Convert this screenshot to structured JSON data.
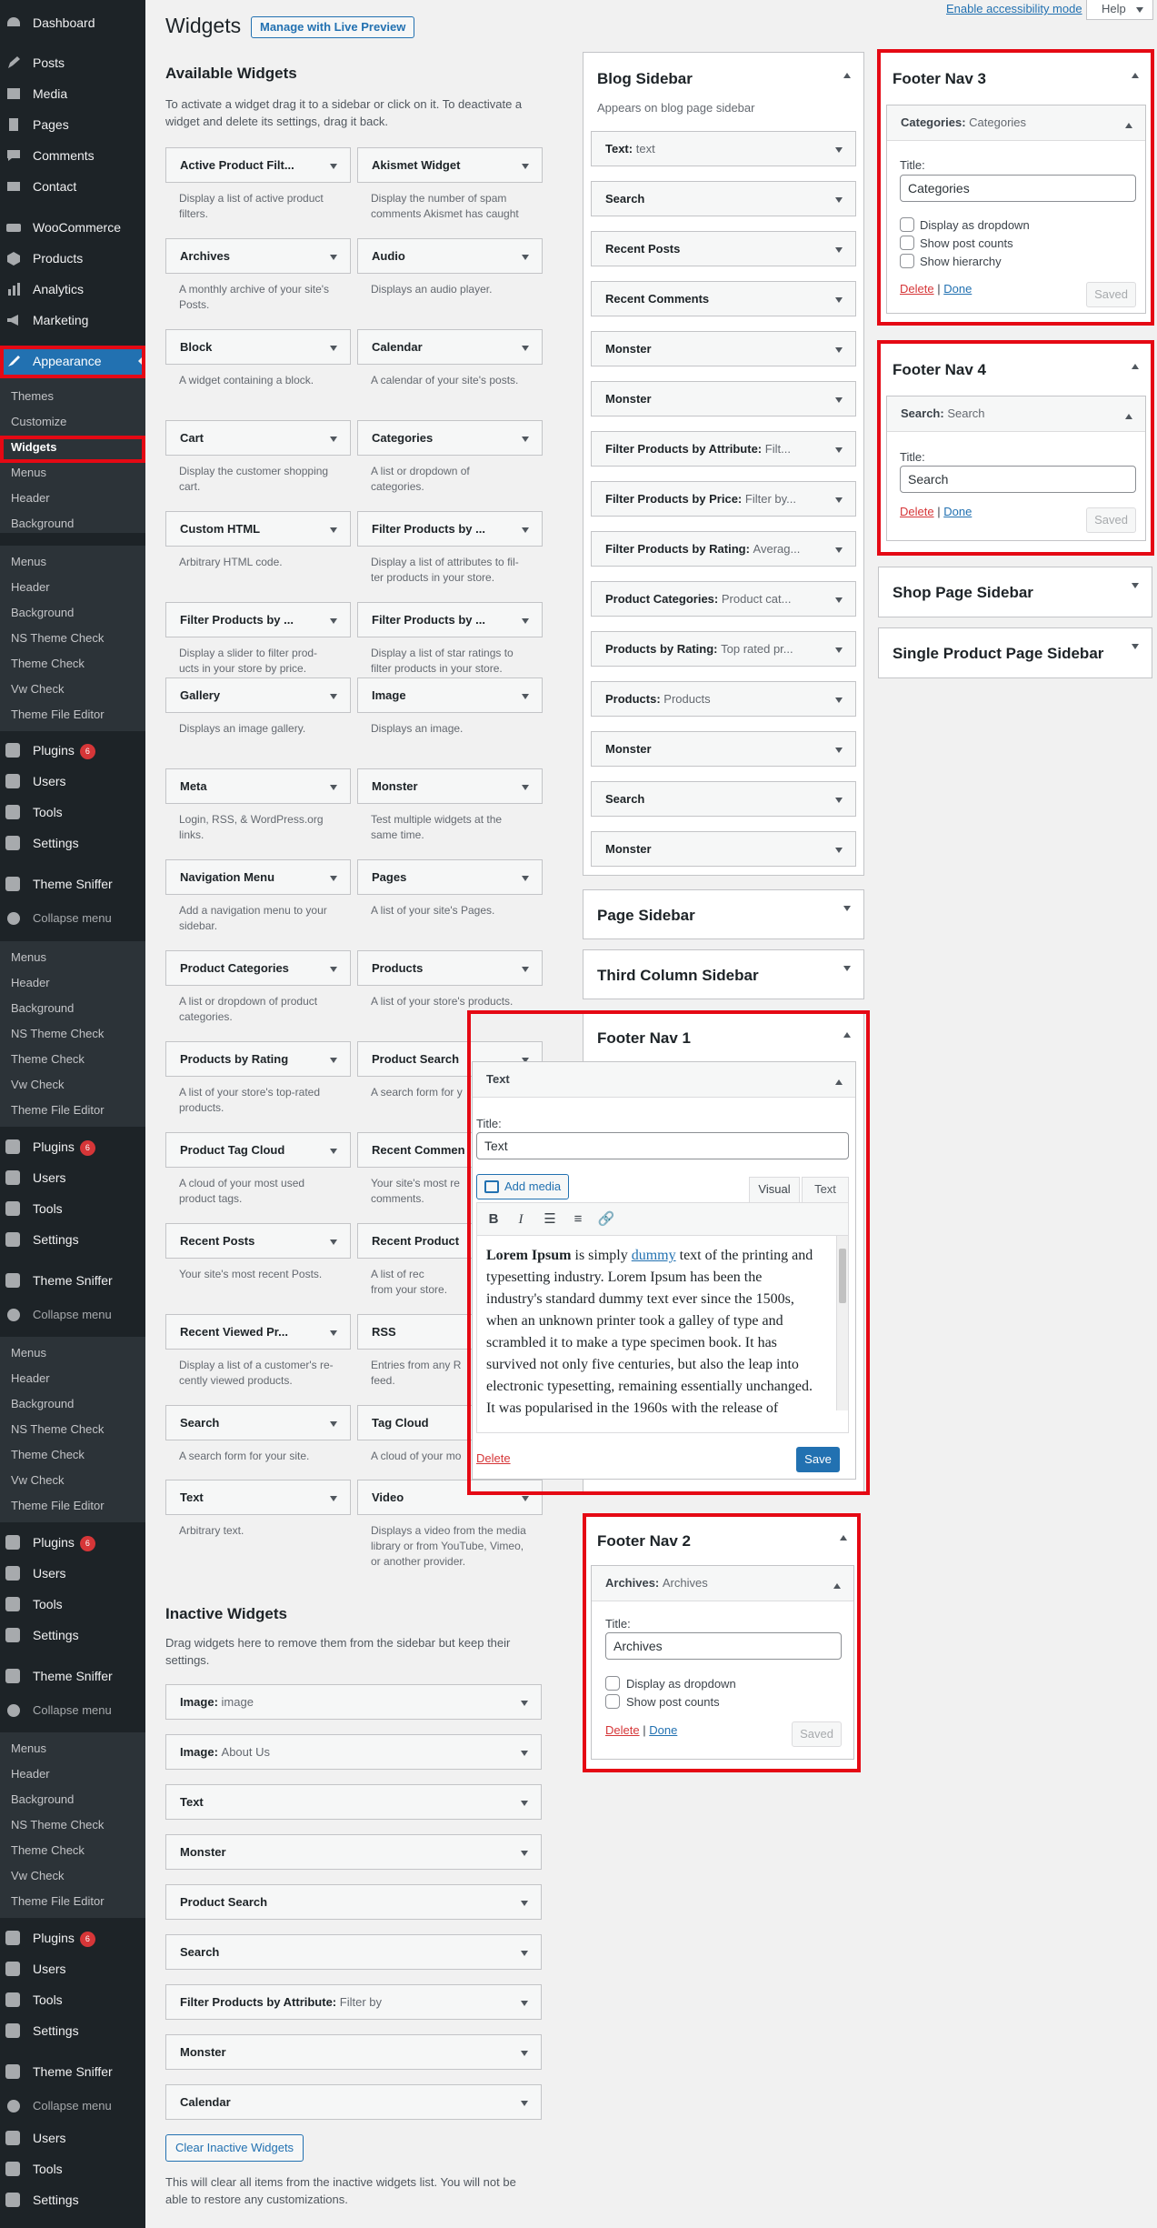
{
  "admin_menu": {
    "top": [
      {
        "label": "Dashboard",
        "icon": "dashboard-icon"
      },
      {
        "label": "Posts",
        "icon": "posts-icon"
      },
      {
        "label": "Media",
        "icon": "media-icon"
      },
      {
        "label": "Pages",
        "icon": "pages-icon"
      },
      {
        "label": "Comments",
        "icon": "comments-icon"
      },
      {
        "label": "Contact",
        "icon": "mail-icon"
      },
      {
        "label": "WooCommerce",
        "icon": "woocommerce-icon"
      },
      {
        "label": "Products",
        "icon": "products-icon"
      },
      {
        "label": "Analytics",
        "icon": "analytics-icon"
      },
      {
        "label": "Marketing",
        "icon": "marketing-icon"
      },
      {
        "label": "Appearance",
        "icon": "appearance-icon"
      }
    ],
    "appearance_sub": [
      "Themes",
      "Customize",
      "Widgets",
      "Menus",
      "Header",
      "Background"
    ],
    "extra_sub_a": [
      "Menus",
      "Header",
      "Background",
      "NS Theme Check",
      "Theme Check",
      "Vw Check",
      "Theme File Editor"
    ],
    "bottom": [
      {
        "label": "Plugins",
        "icon": "plugins-icon",
        "badge": "6"
      },
      {
        "label": "Users",
        "icon": "users-icon"
      },
      {
        "label": "Tools",
        "icon": "tools-icon"
      },
      {
        "label": "Settings",
        "icon": "settings-icon"
      },
      {
        "label": "Theme Sniffer",
        "icon": "theme-sniffer-icon"
      }
    ],
    "collapse": "Collapse menu",
    "final": [
      {
        "label": "Users",
        "icon": "users-icon"
      },
      {
        "label": "Tools",
        "icon": "tools-icon"
      },
      {
        "label": "Settings",
        "icon": "settings-icon"
      }
    ]
  },
  "topbar": {
    "accessibility": "Enable accessibility mode",
    "help": "Help"
  },
  "page": {
    "title": "Widgets",
    "live_preview": "Manage with Live Preview"
  },
  "available": {
    "heading": "Available Widgets",
    "desc1": "To activate a widget drag it to a sidebar or click on it. To deactivate a",
    "desc2": "widget and delete its settings, drag it back.",
    "widgets": [
      {
        "name": "Active Product Filt...",
        "d1": "Display a list of active product",
        "d2": "filters."
      },
      {
        "name": "Akismet Widget",
        "d1": "Display the number of spam",
        "d2": "comments Akismet has caught"
      },
      {
        "name": "Archives",
        "d1": "A monthly archive of your site's",
        "d2": "Posts."
      },
      {
        "name": "Audio",
        "d1": "Displays an audio player.",
        "d2": ""
      },
      {
        "name": "Block",
        "d1": "A widget containing a block.",
        "d2": ""
      },
      {
        "name": "Calendar",
        "d1": "A calendar of your site's posts.",
        "d2": ""
      },
      {
        "name": "Cart",
        "d1": "Display the customer shopping",
        "d2": "cart."
      },
      {
        "name": "Categories",
        "d1": "A list or dropdown of",
        "d2": "categories."
      },
      {
        "name": "Custom HTML",
        "d1": "Arbitrary HTML code.",
        "d2": ""
      },
      {
        "name": "Filter Products by ...",
        "d1": "Display a list of attributes to fil-",
        "d2": "ter products in your store."
      },
      {
        "name": "Filter Products by ...",
        "d1": "Display a slider to filter prod-",
        "d2": "ucts in your store by price."
      },
      {
        "name": "Filter Products by ...",
        "d1": "Display a list of star ratings to",
        "d2": "filter products in your store."
      },
      {
        "name": "Gallery",
        "d1": "Displays an image gallery.",
        "d2": ""
      },
      {
        "name": "Image",
        "d1": "Displays an image.",
        "d2": ""
      },
      {
        "name": "Meta",
        "d1": "Login, RSS, & WordPress.org",
        "d2": "links."
      },
      {
        "name": "Monster",
        "d1": "Test multiple widgets at the",
        "d2": "same time."
      },
      {
        "name": "Navigation Menu",
        "d1": "Add a navigation menu to your",
        "d2": "sidebar."
      },
      {
        "name": "Pages",
        "d1": "A list of your site's Pages.",
        "d2": ""
      },
      {
        "name": "Product Categories",
        "d1": "A list or dropdown of product",
        "d2": "categories."
      },
      {
        "name": "Products",
        "d1": "A list of your store's products.",
        "d2": ""
      },
      {
        "name": "Products by Rating",
        "d1": "A list of your store's top-rated",
        "d2": "products."
      },
      {
        "name": "Product Search",
        "d1": "A search form for y",
        "d2": ""
      },
      {
        "name": "Product Tag Cloud",
        "d1": "A cloud of your most used",
        "d2": "product tags."
      },
      {
        "name": "Recent Commen",
        "d1": "Your site's most re",
        "d2": "comments."
      },
      {
        "name": "Recent Posts",
        "d1": "Your site's most recent Posts.",
        "d2": ""
      },
      {
        "name": "Recent Product",
        "d1": "A list of rec",
        "d2": "from your store."
      },
      {
        "name": "Recent Viewed Pr...",
        "d1": "Display a list of a customer's re-",
        "d2": "cently viewed products."
      },
      {
        "name": "RSS",
        "d1": "Entries from any R",
        "d2": "feed."
      },
      {
        "name": "Search",
        "d1": "A search form for your site.",
        "d2": ""
      },
      {
        "name": "Tag Cloud",
        "d1": "A cloud of your mo",
        "d2": ""
      },
      {
        "name": "Text",
        "d1": "Arbitrary text.",
        "d2": ""
      },
      {
        "name": "Video",
        "d1": "Displays a video from the media",
        "d2": "library or from YouTube, Vimeo,",
        "d3": "or another provider."
      }
    ]
  },
  "inactive": {
    "heading": "Inactive Widgets",
    "desc1": "Drag widgets here to remove them from the sidebar but keep their",
    "desc2": "settings.",
    "widgets": [
      {
        "name": "Image:",
        "title": "image"
      },
      {
        "name": "Image:",
        "title": "About Us"
      },
      {
        "name": "Text",
        "title": ""
      },
      {
        "name": "Monster",
        "title": ""
      },
      {
        "name": "Product Search",
        "title": ""
      },
      {
        "name": "Search",
        "title": ""
      },
      {
        "name": "Filter Products by Attribute:",
        "title": "Filter by"
      },
      {
        "name": "Monster",
        "title": ""
      },
      {
        "name": "Calendar",
        "title": ""
      }
    ],
    "clear": "Clear Inactive Widgets",
    "warn1": "This will clear all items from the inactive widgets list. You will not be",
    "warn2": "able to restore any customizations."
  },
  "blog_sidebar": {
    "title": "Blog Sidebar",
    "desc": "Appears on blog page sidebar",
    "widgets": [
      {
        "name": "Text:",
        "title": "text"
      },
      {
        "name": "Search",
        "title": ""
      },
      {
        "name": "Recent Posts",
        "title": ""
      },
      {
        "name": "Recent Comments",
        "title": ""
      },
      {
        "name": "Monster",
        "title": ""
      },
      {
        "name": "Monster",
        "title": ""
      },
      {
        "name": "Filter Products by Attribute:",
        "title": "Filt..."
      },
      {
        "name": "Filter Products by Price:",
        "title": "Filter by..."
      },
      {
        "name": "Filter Products by Rating:",
        "title": "Averag..."
      },
      {
        "name": "Product Categories:",
        "title": "Product cat..."
      },
      {
        "name": "Products by Rating:",
        "title": "Top rated pr..."
      },
      {
        "name": "Products:",
        "title": "Products"
      },
      {
        "name": "Monster",
        "title": ""
      },
      {
        "name": "Search",
        "title": ""
      },
      {
        "name": "Monster",
        "title": ""
      }
    ]
  },
  "page_sidebar": {
    "title": "Page Sidebar"
  },
  "third_sidebar": {
    "title": "Third Column Sidebar"
  },
  "footer1": {
    "title": "Footer Nav 1",
    "widget": "Text",
    "title_label": "Title:",
    "title_value": "Text",
    "add_media": "Add media",
    "tab_visual": "Visual",
    "tab_text": "Text",
    "content_strong": "Lorem Ipsum",
    "content_a": " is simply ",
    "content_link": "dummy",
    "content_b": " text of the printing and typesetting industry. Lorem Ipsum has been the industry's standard dummy text ever since the 1500s, when an unknown printer took a galley of type and scrambled it to make a type specimen book. It has survived not only five centuries, but also the leap into electronic typesetting, remaining essentially unchanged. It was popularised in the 1960s with the release of",
    "delete": "Delete",
    "save": "Save"
  },
  "footer2": {
    "title": "Footer Nav 2",
    "widget": "Archives:",
    "widget_title": "Archives",
    "title_label": "Title:",
    "title_value": "Archives",
    "opt1": "Display as dropdown",
    "opt2": "Show post counts",
    "delete": "Delete",
    "sep": "|",
    "done": "Done",
    "saved": "Saved"
  },
  "footer3": {
    "title": "Footer Nav 3",
    "widget": "Categories:",
    "widget_title": "Categories",
    "title_label": "Title:",
    "title_value": "Categories",
    "opt1": "Display as dropdown",
    "opt2": "Show post counts",
    "opt3": "Show hierarchy",
    "delete": "Delete",
    "sep": "|",
    "done": "Done",
    "saved": "Saved"
  },
  "footer4": {
    "title": "Footer Nav 4",
    "widget": "Search:",
    "widget_title": "Search",
    "title_label": "Title:",
    "title_value": "Search",
    "delete": "Delete",
    "sep": "|",
    "done": "Done",
    "saved": "Saved"
  },
  "shop_sidebar": {
    "title": "Shop Page Sidebar"
  },
  "single_product_sidebar": {
    "title": "Single Product Page Sidebar"
  }
}
